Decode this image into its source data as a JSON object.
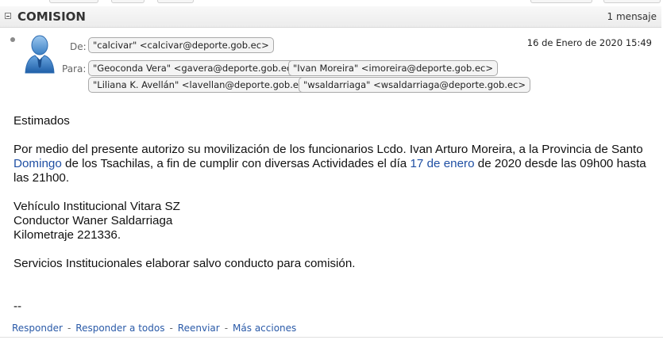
{
  "thread": {
    "subject": "COMISION",
    "message_count": "1 mensaje"
  },
  "message": {
    "from_label": "De:",
    "from": "\"calcivar\" <calcivar@deporte.gob.ec>",
    "to_label": "Para:",
    "to": [
      "\"Geoconda Vera\" <gavera@deporte.gob.ec>",
      "\"Ivan Moreira\" <imoreira@deporte.gob.ec>",
      "\"Liliana K. Avellán\" <lavellan@deporte.gob.ec>",
      "\"wsaldarriaga\" <wsaldarriaga@deporte.gob.ec>"
    ],
    "date": "16 de Enero de 2020 15:49",
    "body": {
      "greeting": "Estimados",
      "p1_a": "Por medio del presente autorizo su movilización de los funcionarios Lcdo. Ivan Arturo Moreira, a la Provincia de Santo ",
      "p1_link1": "Domingo",
      "p1_b": " de los Tsachilas, a fin de cumplir con diversas Actividades el día ",
      "p1_link2": "17 de enero",
      "p1_c": " de 2020 desde las 09h00 hasta las 21h00.",
      "line_vehicle": "Vehículo Institucional Vitara SZ",
      "line_driver": "Conductor Waner Saldarriaga",
      "line_km": "Kilometraje 221336.",
      "line_services": "Servicios Institucionales elaborar salvo conducto para comisión.",
      "signature": "--"
    }
  },
  "actions": {
    "reply": "Responder",
    "reply_all": "Responder a todos",
    "forward": "Reenviar",
    "more": "Más acciones",
    "separator": "-"
  },
  "colors": {
    "link": "#1f4fa3",
    "action_link": "#2a5aa8"
  }
}
